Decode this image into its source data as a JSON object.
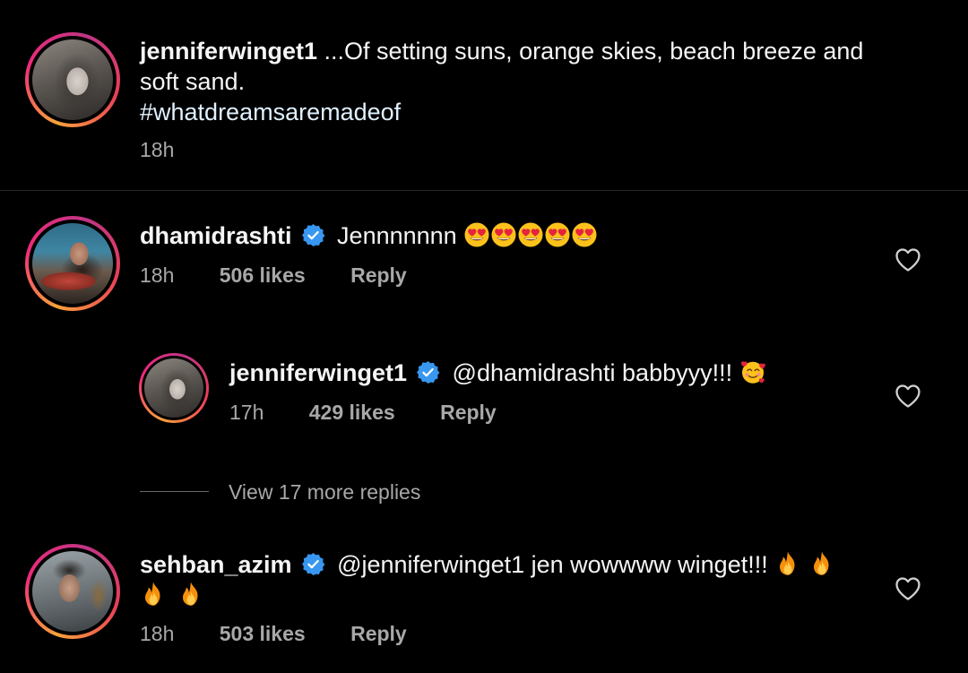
{
  "caption": {
    "username": "jenniferwinget1",
    "text_line1": " ...Of setting suns, orange skies, beach breeze and",
    "text_line2": "soft sand.",
    "hashtag": "#whatdreamsaremadeof",
    "time": "18h"
  },
  "comments": [
    {
      "username": "dhamidrashti",
      "verified": true,
      "text": "Jennnnnnn",
      "emoji": [
        "heart-eyes",
        "heart-eyes",
        "heart-eyes",
        "heart-eyes",
        "heart-eyes"
      ],
      "time": "18h",
      "likes": "506 likes",
      "reply": "Reply"
    },
    {
      "username": "jenniferwinget1",
      "verified": true,
      "text": "@dhamidrashti babbyyy!!!",
      "emoji": [
        "smiling-face-with-hearts"
      ],
      "time": "17h",
      "likes": "429 likes",
      "reply": "Reply"
    },
    {
      "username": "sehban_azim",
      "verified": true,
      "text": "@jenniferwinget1 jen wowwww winget!!!",
      "emoji": [
        "fire",
        "fire",
        "fire",
        "fire"
      ],
      "time": "18h",
      "likes": "503 likes",
      "reply": "Reply"
    }
  ],
  "view_more": "View 17 more replies",
  "colors": {
    "background": "#000000",
    "text": "#f5f5f5",
    "muted": "#a8a8a8",
    "verified": "#3897f0",
    "divider": "#262626"
  },
  "icons": {
    "verified": "verified-badge-icon",
    "like": "heart-outline-icon"
  }
}
